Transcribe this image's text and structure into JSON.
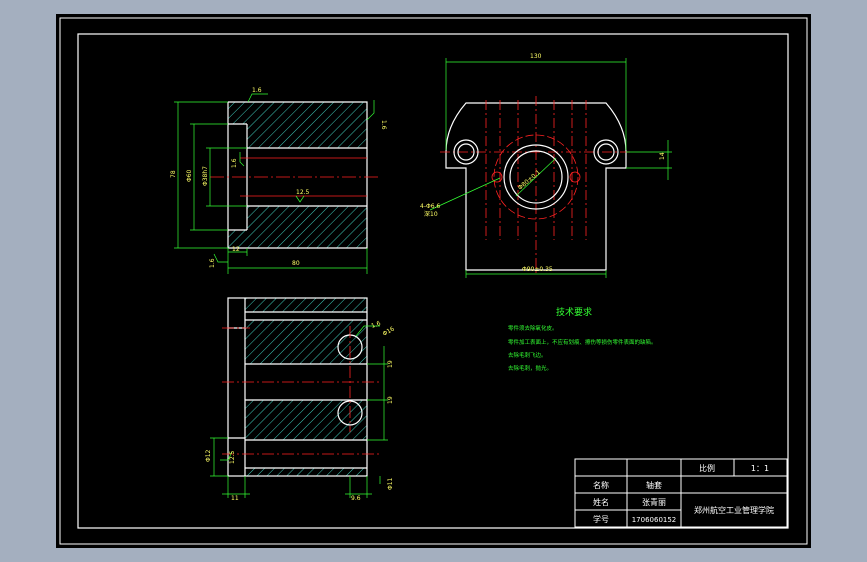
{
  "drawing": {
    "colors": {
      "background": "#000000",
      "window_frame": "#a4afbf",
      "border": "#ffffff",
      "part_outline": "#ffffff",
      "dimension": "#33ff33",
      "center_line": "#ff2222",
      "hatch": "#3ec9b8",
      "dimension_text": "#ffff66"
    },
    "front_view": {
      "dims": {
        "top_note": "1.6",
        "right_note": "1.6",
        "left_note": "1.6",
        "height_outer": "78",
        "height_mid": "Φ60",
        "height_inner": "Φ38h7",
        "bore_mark": "1.6",
        "inner_ra": "12.5",
        "bottom_width": "80",
        "bottom_step": "12"
      }
    },
    "top_view": {
      "dims": {
        "top_width": "130",
        "side_height": "14",
        "bottom_width": "Φ90±0.35",
        "hole_label_1": "4-Φ6.6",
        "hole_label_2": "深10",
        "bolt_circle": "Φ80±0.1"
      }
    },
    "section_view": {
      "dims": {
        "chamfer_1": "1.6",
        "chamfer_2": "Φ16",
        "height_1": "19",
        "height_2": "19",
        "left_dia": "Φ12",
        "ra": "12.5",
        "bottom_1": "11",
        "bottom_2": "9.6",
        "bottom_3": "Φ11"
      }
    },
    "notes": {
      "title": "技术要求",
      "lines": [
        "零件须去除氧化皮。",
        "零件加工表面上，不应有划痕、擦伤等损伤零件表面的缺陷。",
        "去除毛刺飞边。",
        "去除毛刺，抛光。"
      ]
    },
    "title_block": {
      "scale_label": "比例",
      "scale_value": "1：1",
      "name_label": "名称",
      "name_value": "轴套",
      "author_label": "姓名",
      "author_value": "张青丽",
      "id_label": "学号",
      "id_value": "1706060152",
      "school": "郑州航空工业管理学院"
    }
  }
}
